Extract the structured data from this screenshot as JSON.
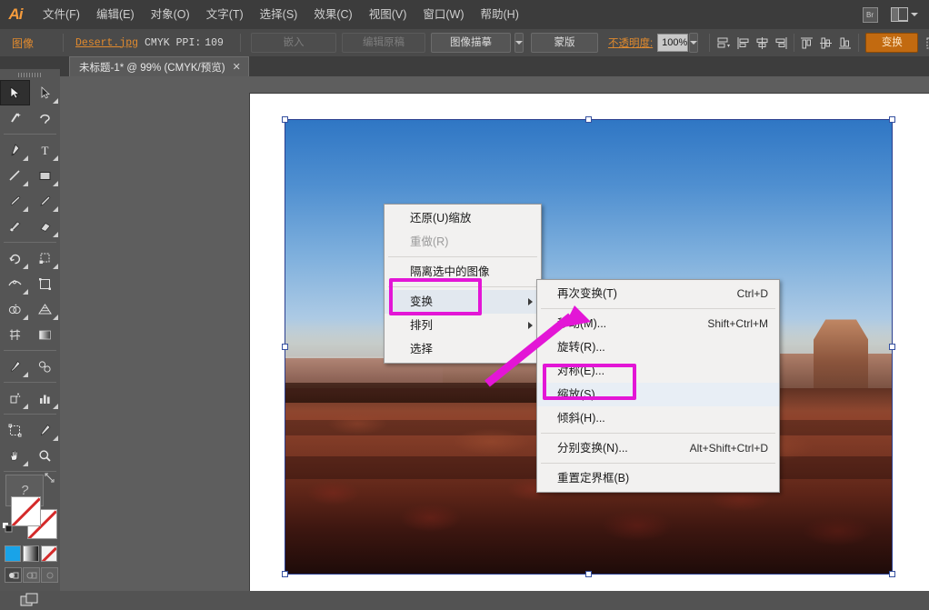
{
  "app": {
    "name": "Adobe Illustrator",
    "logo": "Ai"
  },
  "menubar": {
    "items": [
      {
        "label": "文件(F)",
        "name": "menu-file"
      },
      {
        "label": "编辑(E)",
        "name": "menu-edit"
      },
      {
        "label": "对象(O)",
        "name": "menu-object"
      },
      {
        "label": "文字(T)",
        "name": "menu-type"
      },
      {
        "label": "选择(S)",
        "name": "menu-select"
      },
      {
        "label": "效果(C)",
        "name": "menu-effect"
      },
      {
        "label": "视图(V)",
        "name": "menu-view"
      },
      {
        "label": "窗口(W)",
        "name": "menu-window"
      },
      {
        "label": "帮助(H)",
        "name": "menu-help"
      }
    ],
    "bridge_icon": "Br",
    "workspace_icon": "workspace-switcher"
  },
  "controlbar": {
    "selection_label": "图像",
    "file_link": "Desert.jpg",
    "color_mode": "CMYK",
    "ppi_label": "PPI:",
    "ppi_value": "109",
    "embed_button": "嵌入",
    "edit_original_button": "编辑原稿",
    "image_trace_button": "图像描摹",
    "mask_button": "蒙版",
    "opacity_label": "不透明度:",
    "opacity_value": "100%",
    "transform_button": "变换",
    "align_icons": [
      "align-options-icon",
      "align-left-icon",
      "align-center-horizontal-icon",
      "align-right-icon",
      "align-top-icon",
      "align-center-vertical-icon",
      "align-bottom-icon"
    ],
    "last_icon": "document-setup-icon"
  },
  "tabbar": {
    "tab_title": "未标题-1* @ 99% (CMYK/预览)",
    "close_glyph": "✕"
  },
  "toolbar": {
    "tools": [
      {
        "name": "selection-tool",
        "selected": true,
        "flyout": false
      },
      {
        "name": "direct-selection-tool",
        "selected": false,
        "flyout": true
      },
      {
        "name": "magic-wand-tool",
        "selected": false,
        "flyout": false
      },
      {
        "name": "lasso-tool",
        "selected": false,
        "flyout": false
      },
      {
        "name": "pen-tool",
        "selected": false,
        "flyout": true
      },
      {
        "name": "type-tool",
        "selected": false,
        "flyout": true
      },
      {
        "name": "line-segment-tool",
        "selected": false,
        "flyout": true
      },
      {
        "name": "rectangle-tool",
        "selected": false,
        "flyout": true
      },
      {
        "name": "paintbrush-tool",
        "selected": false,
        "flyout": true
      },
      {
        "name": "pencil-tool",
        "selected": false,
        "flyout": true
      },
      {
        "name": "blob-brush-tool",
        "selected": false,
        "flyout": false
      },
      {
        "name": "eraser-tool",
        "selected": false,
        "flyout": true
      },
      {
        "name": "rotate-tool",
        "selected": false,
        "flyout": true
      },
      {
        "name": "scale-tool",
        "selected": false,
        "flyout": true
      },
      {
        "name": "width-tool",
        "selected": false,
        "flyout": true
      },
      {
        "name": "free-transform-tool",
        "selected": false,
        "flyout": false
      },
      {
        "name": "shape-builder-tool",
        "selected": false,
        "flyout": true
      },
      {
        "name": "perspective-grid-tool",
        "selected": false,
        "flyout": true
      },
      {
        "name": "mesh-tool",
        "selected": false,
        "flyout": false
      },
      {
        "name": "gradient-tool",
        "selected": false,
        "flyout": false
      },
      {
        "name": "eyedropper-tool",
        "selected": false,
        "flyout": true
      },
      {
        "name": "blend-tool",
        "selected": false,
        "flyout": false
      },
      {
        "name": "symbol-sprayer-tool",
        "selected": false,
        "flyout": true
      },
      {
        "name": "column-graph-tool",
        "selected": false,
        "flyout": true
      },
      {
        "name": "artboard-tool",
        "selected": false,
        "flyout": false
      },
      {
        "name": "slice-tool",
        "selected": false,
        "flyout": true
      },
      {
        "name": "hand-tool",
        "selected": false,
        "flyout": true
      },
      {
        "name": "zoom-tool",
        "selected": false,
        "flyout": false
      }
    ],
    "help_glyph": "?",
    "fill_label": "fill-swatch-none",
    "stroke_label": "stroke-swatch-none",
    "mode_buttons": [
      "color-mode-button",
      "gradient-mode-button",
      "none-mode-button"
    ],
    "draw_buttons": [
      "draw-normal-button",
      "draw-behind-button",
      "draw-inside-button"
    ],
    "screen_mode": "screen-mode-button"
  },
  "canvas": {
    "document_name": "未标题-1",
    "zoom_level": "99%",
    "artwork": {
      "name": "Desert.jpg",
      "description": "desert-mesa-landscape"
    },
    "selection_handles": 8
  },
  "context_menu": {
    "items": [
      {
        "label": "还原(U)缩放",
        "name": "ctx-undo-scale",
        "disabled": false,
        "submenu": false,
        "highlighted": false,
        "sep_after": false
      },
      {
        "label": "重做(R)",
        "name": "ctx-redo",
        "disabled": true,
        "submenu": false,
        "highlighted": false,
        "sep_after": true
      },
      {
        "label": "隔离选中的图像",
        "name": "ctx-isolate-image",
        "disabled": false,
        "submenu": false,
        "highlighted": false,
        "sep_after": true
      },
      {
        "label": "变换",
        "name": "ctx-transform",
        "disabled": false,
        "submenu": true,
        "highlighted": true,
        "sep_after": false
      },
      {
        "label": "排列",
        "name": "ctx-arrange",
        "disabled": false,
        "submenu": true,
        "highlighted": false,
        "sep_after": false
      },
      {
        "label": "选择",
        "name": "ctx-select",
        "disabled": false,
        "submenu": true,
        "highlighted": false,
        "sep_after": false
      }
    ]
  },
  "submenu": {
    "items": [
      {
        "label": "再次变换(T)",
        "shortcut": "Ctrl+D",
        "name": "sub-transform-again",
        "highlighted": false,
        "sep_after": true
      },
      {
        "label": "移动(M)...",
        "shortcut": "Shift+Ctrl+M",
        "name": "sub-move",
        "highlighted": false,
        "sep_after": false
      },
      {
        "label": "旋转(R)...",
        "shortcut": "",
        "name": "sub-rotate",
        "highlighted": false,
        "sep_after": false
      },
      {
        "label": "对称(E)...",
        "shortcut": "",
        "name": "sub-reflect",
        "highlighted": false,
        "sep_after": false
      },
      {
        "label": "缩放(S)...",
        "shortcut": "",
        "name": "sub-scale",
        "highlighted": true,
        "sep_after": false
      },
      {
        "label": "倾斜(H)...",
        "shortcut": "",
        "name": "sub-shear",
        "highlighted": false,
        "sep_after": true
      },
      {
        "label": "分别变换(N)...",
        "shortcut": "Alt+Shift+Ctrl+D",
        "name": "sub-transform-each",
        "highlighted": false,
        "sep_after": true
      },
      {
        "label": "重置定界框(B)",
        "shortcut": "",
        "name": "sub-reset-bounding-box",
        "highlighted": false,
        "sep_after": false
      }
    ]
  },
  "annotations": {
    "highlight_color": "#e316d6",
    "boxes": [
      "transform-menu-highlight",
      "scale-menu-highlight"
    ],
    "arrow": "magenta-pointer-arrow"
  },
  "colors": {
    "accent_orange": "#e08a2e",
    "chrome_dark": "#3c3c3c",
    "chrome_mid": "#4a4a4a",
    "canvas_gray": "#5e5e5e",
    "selection_blue": "#2b3f8f",
    "highlight_magenta": "#e316d6"
  }
}
